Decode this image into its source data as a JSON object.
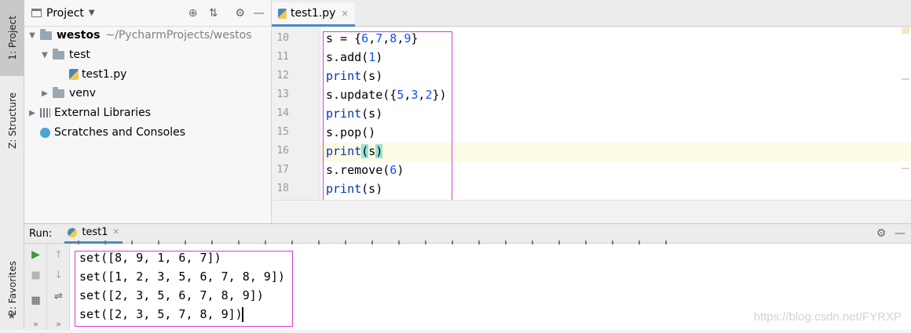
{
  "left_strip": {
    "project_tab": "1: Project",
    "structure_tab": "Z: Structure",
    "favorites_tab": "2: Favorites"
  },
  "project_panel": {
    "title": "Project",
    "tree": {
      "root_name": "westos",
      "root_path": "~/PycharmProjects/westos",
      "test_folder": "test",
      "file": "test1.py",
      "venv": "venv",
      "external_libraries": "External Libraries",
      "scratches": "Scratches and Consoles"
    }
  },
  "editor": {
    "tab_label": "test1.py",
    "line_numbers": [
      "10",
      "11",
      "12",
      "13",
      "14",
      "15",
      "16",
      "17",
      "18"
    ],
    "code": {
      "l10": {
        "a": "s = {",
        "n1": "6",
        "c1": ",",
        "n2": "7",
        "c2": ",",
        "n3": "8",
        "c3": ",",
        "n4": "9",
        "z": "}"
      },
      "l11": {
        "a": "s.add(",
        "n": "1",
        "z": ")"
      },
      "l12": {
        "kw": "print",
        "z": "(s)"
      },
      "l13": {
        "a": "s.update({",
        "n1": "5",
        "c1": ",",
        "n2": "3",
        "c2": ",",
        "n3": "2",
        "z": "})"
      },
      "l14": {
        "kw": "print",
        "z": "(s)"
      },
      "l15": {
        "a": "s.pop()"
      },
      "l16": {
        "kw": "print",
        "p1": "(",
        "s": "s",
        "p2": ")"
      },
      "l17": {
        "a": "s.remove(",
        "n": "6",
        "z": ")"
      },
      "l18": {
        "kw": "print",
        "z": "(s)"
      }
    }
  },
  "run_panel": {
    "label": "Run:",
    "tab": "test1",
    "output": [
      "set([8, 9, 1, 6, 7])",
      "set([1, 2, 3, 5, 6, 7, 8, 9])",
      "set([2, 3, 5, 6, 7, 8, 9])",
      "set([2, 3, 5, 7, 8, 9])"
    ]
  },
  "watermark": "https://blog.csdn.net/FYRXP",
  "colors": {
    "keyword": "#0033b3",
    "number": "#1750eb",
    "highlight_box": "#d63cd6",
    "tab_underline": "#4a88c7"
  },
  "icons": [
    "project-icon",
    "structure-icon",
    "favorites-star-icon",
    "locate-icon",
    "collapse-icon",
    "gear-icon",
    "minimize-icon",
    "python-file-icon",
    "close-icon",
    "run-icon",
    "stop-icon",
    "up-arrow-icon",
    "down-arrow-icon",
    "soft-wrap-icon",
    "layout-icon",
    "more-icon"
  ]
}
